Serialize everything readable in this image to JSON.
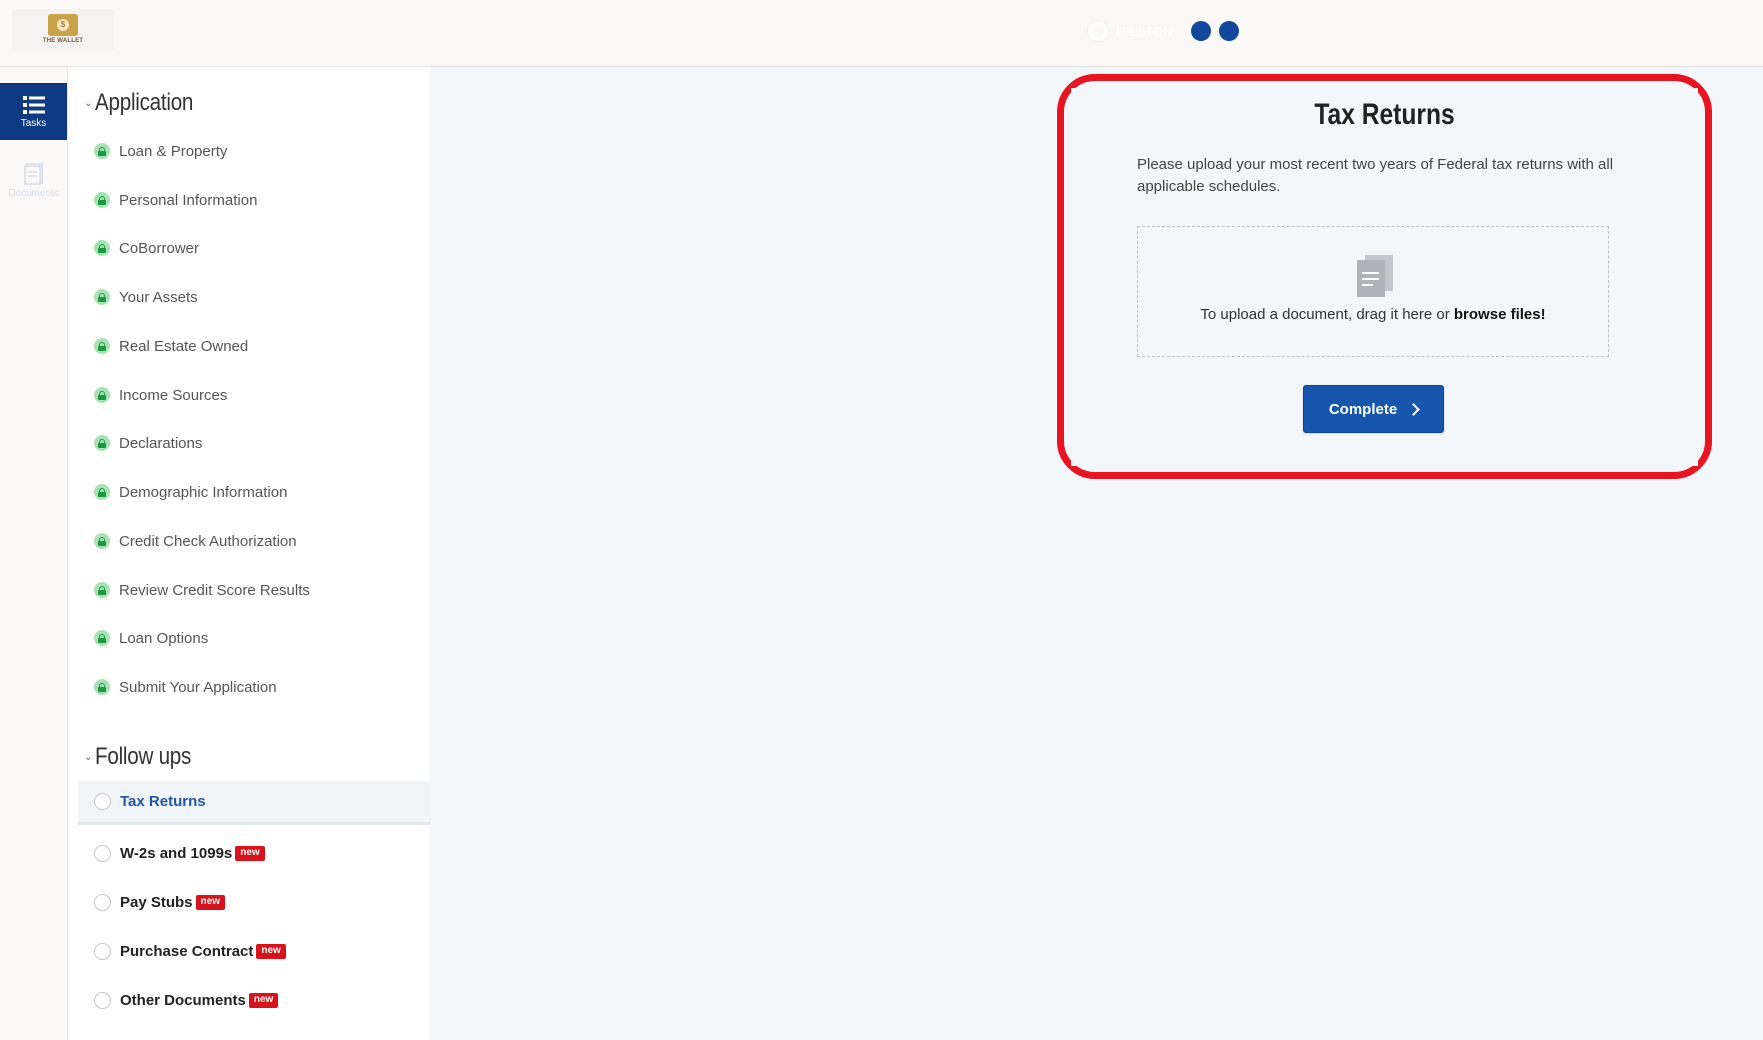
{
  "brand": {
    "logo_text": "THE WALLET"
  },
  "topbar": {
    "status_text": "HILLTON"
  },
  "rail": {
    "tasks_label": "Tasks",
    "documents_label": "Documents"
  },
  "sidebar": {
    "application": {
      "title": "Application",
      "items": [
        {
          "label": "Loan & Property"
        },
        {
          "label": "Personal Information"
        },
        {
          "label": "CoBorrower"
        },
        {
          "label": "Your Assets"
        },
        {
          "label": "Real Estate Owned"
        },
        {
          "label": "Income Sources"
        },
        {
          "label": "Declarations"
        },
        {
          "label": "Demographic Information"
        },
        {
          "label": "Credit Check Authorization"
        },
        {
          "label": "Review Credit Score Results"
        },
        {
          "label": "Loan Options"
        },
        {
          "label": "Submit Your Application"
        }
      ]
    },
    "follow_ups": {
      "title": "Follow ups",
      "items": [
        {
          "label": "Tax Returns",
          "badge": ""
        },
        {
          "label": "W-2s and 1099s",
          "badge": "new"
        },
        {
          "label": "Pay Stubs",
          "badge": "new"
        },
        {
          "label": "Purchase Contract",
          "badge": "new"
        },
        {
          "label": "Other Documents",
          "badge": "new"
        }
      ]
    }
  },
  "main": {
    "title": "Tax Returns",
    "description": "Please upload your most recent two years of Federal tax returns with all applicable schedules.",
    "dropzone": {
      "text": "To upload a document, drag it here or ",
      "link": "browse files!"
    },
    "complete_label": "Complete"
  },
  "colors": {
    "primary": "#1656ad",
    "rail_active": "#0d3a82",
    "highlight": "#e8141f",
    "badge": "#d7141b",
    "lock": "#1a9a3c"
  }
}
